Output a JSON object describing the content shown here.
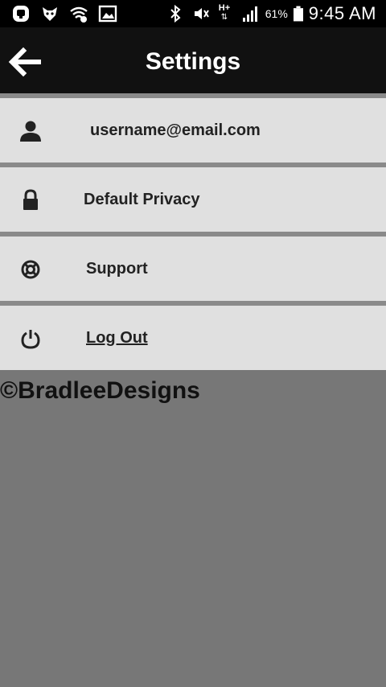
{
  "status_bar": {
    "battery_percent": "61%",
    "time": "9:45 AM",
    "network_label": "H+",
    "icons": [
      "app-notification-icon",
      "fox-notification-icon",
      "wifi-calling-icon",
      "gallery-icon",
      "bluetooth-icon",
      "mute-icon",
      "mobile-data-icon",
      "signal-icon",
      "battery-icon"
    ]
  },
  "app_bar": {
    "title": "Settings",
    "back_icon": "arrow-left-icon"
  },
  "menu": {
    "items": [
      {
        "label": "username@email.com",
        "icon": "person-icon"
      },
      {
        "label": "Default Privacy",
        "icon": "lock-icon"
      },
      {
        "label": "Support",
        "icon": "lifebuoy-icon"
      },
      {
        "label": "Log Out",
        "icon": "power-icon"
      }
    ]
  },
  "watermark": {
    "text": "©BradleeDesigns"
  },
  "colors": {
    "status_bar": "#000000",
    "app_bar": "#111111",
    "menu_item_bg": "#e0e0e0",
    "divider": "#8a8a8a",
    "page_bg": "#777777",
    "text_dark": "#222222"
  }
}
